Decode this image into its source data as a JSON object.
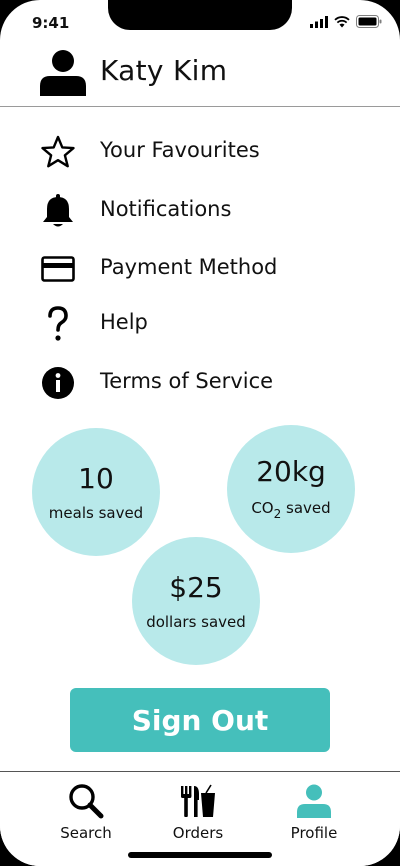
{
  "status_bar": {
    "time": "9:41"
  },
  "profile": {
    "name": "Katy Kim",
    "avatar_icon": "user-icon"
  },
  "menu": [
    {
      "label": "Your Favourites",
      "icon": "star-icon"
    },
    {
      "label": "Notifications",
      "icon": "bell-icon"
    },
    {
      "label": "Payment Method",
      "icon": "credit-card-icon"
    },
    {
      "label": "Help",
      "icon": "question-icon"
    },
    {
      "label": "Terms of Service",
      "icon": "info-icon"
    }
  ],
  "stats": {
    "meals": {
      "value": "10",
      "label": "meals saved"
    },
    "co2": {
      "value": "20kg",
      "label_prefix": "CO",
      "label_sub": "2",
      "label_suffix": " saved"
    },
    "dollars": {
      "value": "$25",
      "label": "dollars saved"
    }
  },
  "sign_out_label": "Sign Out",
  "tabs": [
    {
      "label": "Search",
      "icon": "search-icon",
      "active": false
    },
    {
      "label": "Orders",
      "icon": "cutlery-drink-icon",
      "active": false
    },
    {
      "label": "Profile",
      "icon": "user-icon",
      "active": true
    }
  ],
  "colors": {
    "accent": "#45bfbb",
    "stat_circle": "#b8e9ea",
    "active_tab": "#45bfbb"
  }
}
